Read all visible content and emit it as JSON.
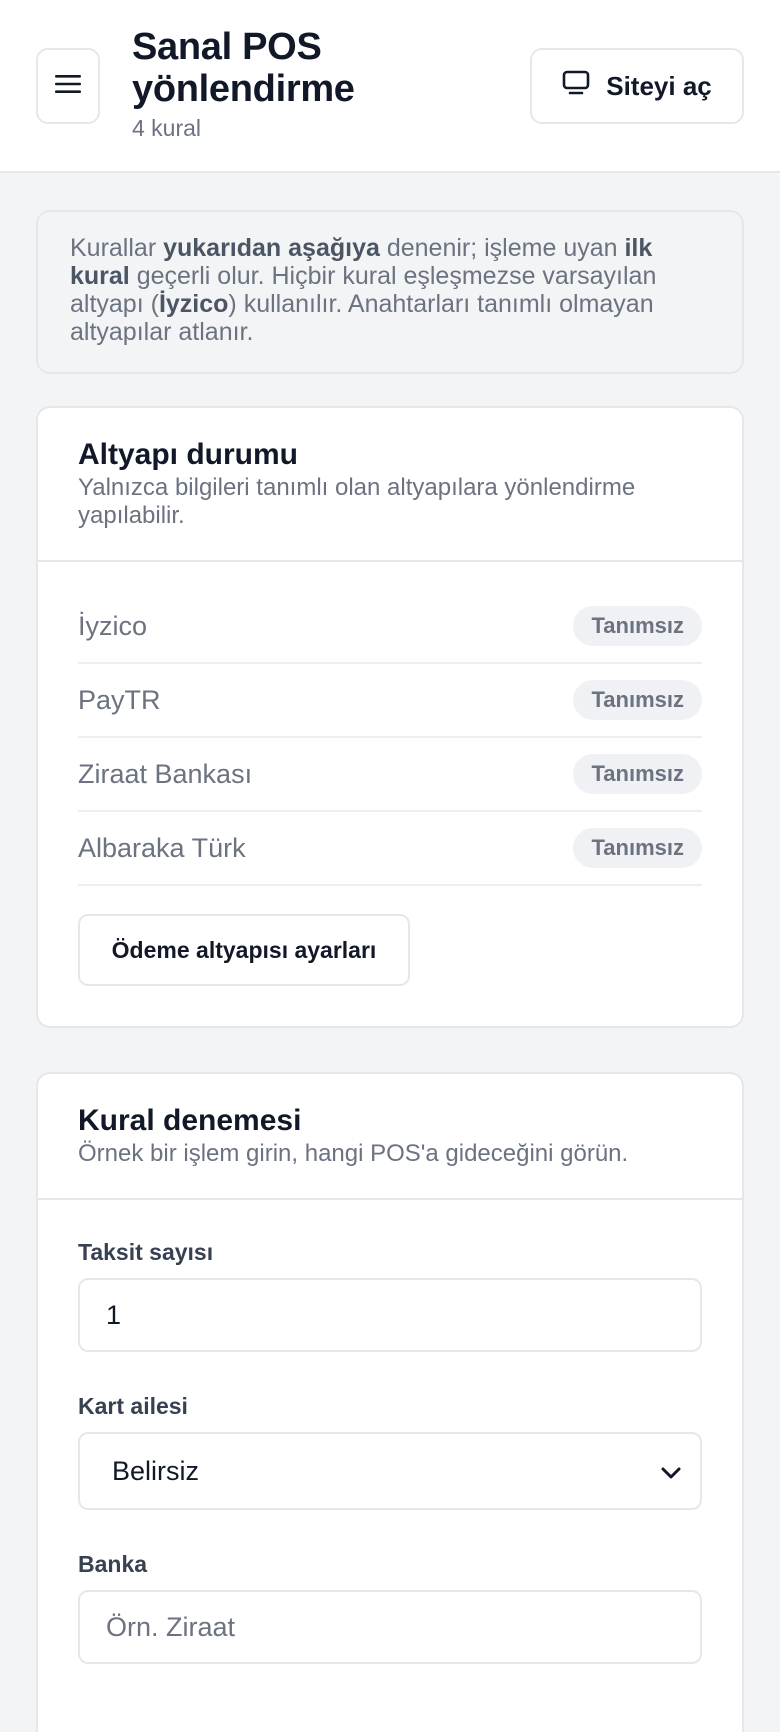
{
  "header": {
    "title": "Sanal POS yönlendirme",
    "subtitle": "4 kural",
    "open_site_label": "Siteyi aç"
  },
  "info": {
    "t1": "Kurallar ",
    "b1": "yukarıdan aşağıya",
    "t2": " denenir; işleme uyan ",
    "b2": "ilk kural",
    "t3": " geçerli olur. Hiçbir kural eşleşmezse varsayılan altyapı (",
    "b3": "İyzico",
    "t4": ") kullanılır. Anahtarları tanımlı olmayan altyapılar atlanır."
  },
  "infra": {
    "title": "Altyapı durumu",
    "description": "Yalnızca bilgileri tanımlı olan altyapılara yönlendirme yapılabilir.",
    "providers": [
      {
        "name": "İyzico",
        "status": "Tanımsız"
      },
      {
        "name": "PayTR",
        "status": "Tanımsız"
      },
      {
        "name": "Ziraat Bankası",
        "status": "Tanımsız"
      },
      {
        "name": "Albaraka Türk",
        "status": "Tanımsız"
      }
    ],
    "settings_button": "Ödeme altyapısı ayarları"
  },
  "test": {
    "title": "Kural denemesi",
    "description": "Örnek bir işlem girin, hangi POS'a gideceğini görün.",
    "installments_label": "Taksit sayısı",
    "installments_value": "1",
    "card_family_label": "Kart ailesi",
    "card_family_value": "Belirsiz",
    "bank_label": "Banka",
    "bank_placeholder": "Örn. Ziraat"
  },
  "colors": {
    "background": "#f3f4f6",
    "card": "#ffffff",
    "border": "#e5e7eb",
    "muted_text": "#6b7280"
  }
}
